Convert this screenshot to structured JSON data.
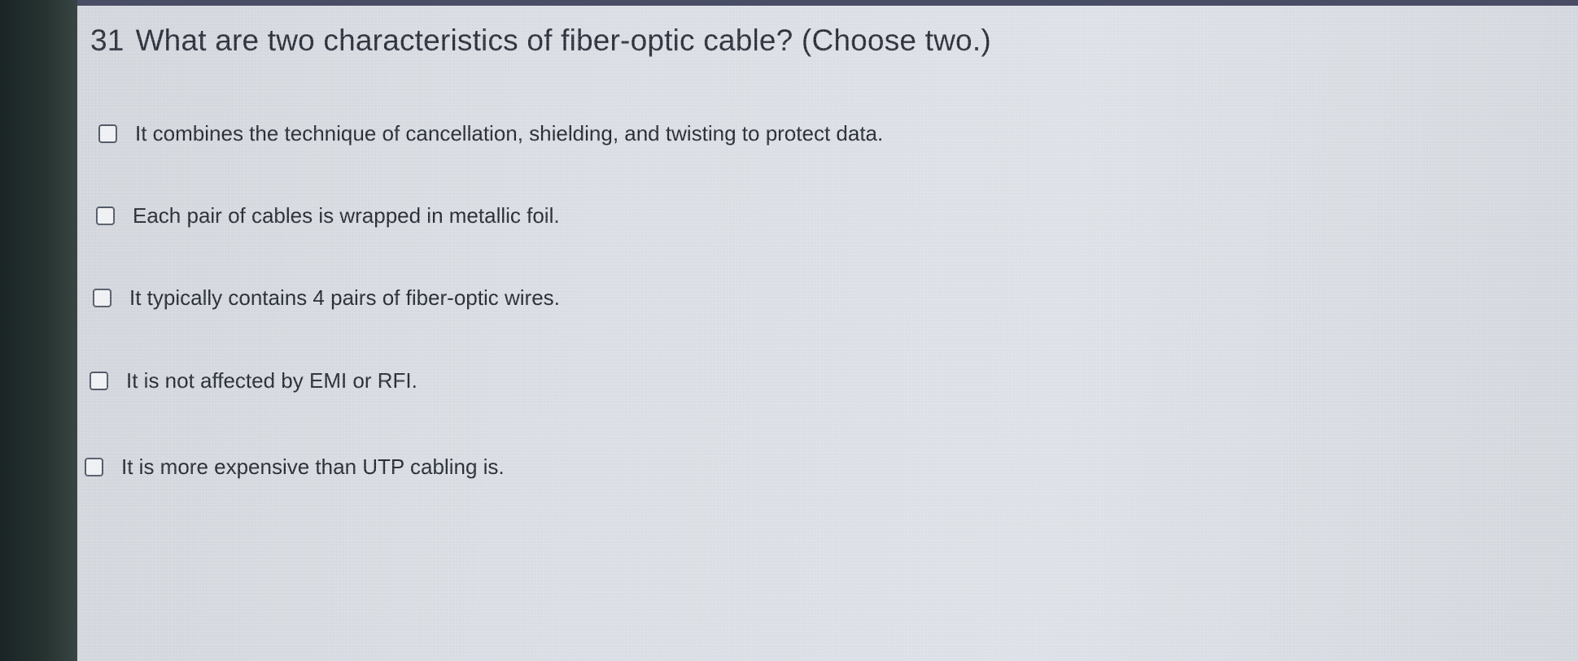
{
  "question": {
    "number": "31",
    "text": "What are two characteristics of fiber-optic cable? (Choose two.)"
  },
  "options": [
    {
      "label": "It combines the technique of cancellation, shielding, and twisting to protect data.",
      "checked": false
    },
    {
      "label": "Each pair of cables is wrapped in metallic foil.",
      "checked": false
    },
    {
      "label": "It typically contains 4 pairs of fiber-optic wires.",
      "checked": false
    },
    {
      "label": "It is not affected by EMI or RFI.",
      "checked": false
    },
    {
      "label": "It is more expensive than UTP cabling is.",
      "checked": false
    }
  ]
}
